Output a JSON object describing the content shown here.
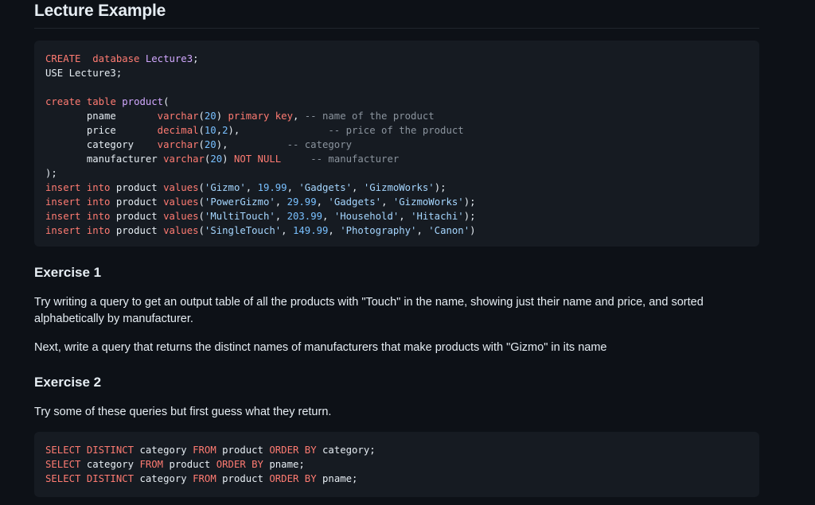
{
  "title": "Lecture Example",
  "lecture_code": [
    [
      [
        "CREATE",
        "kw"
      ],
      [
        "  ",
        ""
      ],
      [
        "database",
        "kw"
      ],
      [
        " ",
        ""
      ],
      [
        "Lecture3",
        "fn"
      ],
      [
        ";",
        ""
      ]
    ],
    [
      [
        "USE Lecture3;",
        ""
      ]
    ],
    [],
    [
      [
        "create",
        "kw"
      ],
      [
        " ",
        ""
      ],
      [
        "table",
        "kw"
      ],
      [
        " ",
        ""
      ],
      [
        "product",
        "fn"
      ],
      [
        "(",
        ""
      ]
    ],
    [
      [
        "       pname       ",
        ""
      ],
      [
        "varchar",
        "kw"
      ],
      [
        "(",
        ""
      ],
      [
        "20",
        "num"
      ],
      [
        ") ",
        ""
      ],
      [
        "primary key",
        "kw"
      ],
      [
        ", ",
        ""
      ],
      [
        "-- name of the product",
        "cm"
      ]
    ],
    [
      [
        "       price       ",
        ""
      ],
      [
        "decimal",
        "kw"
      ],
      [
        "(",
        ""
      ],
      [
        "10",
        "num"
      ],
      [
        ",",
        ""
      ],
      [
        "2",
        "num"
      ],
      [
        "),               ",
        ""
      ],
      [
        "-- price of the product",
        "cm"
      ]
    ],
    [
      [
        "       category    ",
        ""
      ],
      [
        "varchar",
        "kw"
      ],
      [
        "(",
        ""
      ],
      [
        "20",
        "num"
      ],
      [
        "),          ",
        ""
      ],
      [
        "-- category",
        "cm"
      ]
    ],
    [
      [
        "       manufacturer ",
        ""
      ],
      [
        "varchar",
        "kw"
      ],
      [
        "(",
        ""
      ],
      [
        "20",
        "num"
      ],
      [
        ") ",
        ""
      ],
      [
        "NOT NULL",
        "kw"
      ],
      [
        "     ",
        ""
      ],
      [
        "-- manufacturer",
        "cm"
      ]
    ],
    [
      [
        ");",
        ""
      ]
    ],
    [
      [
        "insert",
        "kw"
      ],
      [
        " ",
        ""
      ],
      [
        "into",
        "kw"
      ],
      [
        " product ",
        ""
      ],
      [
        "values",
        "kw"
      ],
      [
        "(",
        ""
      ],
      [
        "'Gizmo'",
        "str"
      ],
      [
        ", ",
        ""
      ],
      [
        "19.99",
        "num"
      ],
      [
        ", ",
        ""
      ],
      [
        "'Gadgets'",
        "str"
      ],
      [
        ", ",
        ""
      ],
      [
        "'GizmoWorks'",
        "str"
      ],
      [
        ");",
        ""
      ]
    ],
    [
      [
        "insert",
        "kw"
      ],
      [
        " ",
        ""
      ],
      [
        "into",
        "kw"
      ],
      [
        " product ",
        ""
      ],
      [
        "values",
        "kw"
      ],
      [
        "(",
        ""
      ],
      [
        "'PowerGizmo'",
        "str"
      ],
      [
        ", ",
        ""
      ],
      [
        "29.99",
        "num"
      ],
      [
        ", ",
        ""
      ],
      [
        "'Gadgets'",
        "str"
      ],
      [
        ", ",
        ""
      ],
      [
        "'GizmoWorks'",
        "str"
      ],
      [
        ");",
        ""
      ]
    ],
    [
      [
        "insert",
        "kw"
      ],
      [
        " ",
        ""
      ],
      [
        "into",
        "kw"
      ],
      [
        " product ",
        ""
      ],
      [
        "values",
        "kw"
      ],
      [
        "(",
        ""
      ],
      [
        "'MultiTouch'",
        "str"
      ],
      [
        ", ",
        ""
      ],
      [
        "203.99",
        "num"
      ],
      [
        ", ",
        ""
      ],
      [
        "'Household'",
        "str"
      ],
      [
        ", ",
        ""
      ],
      [
        "'Hitachi'",
        "str"
      ],
      [
        ");",
        ""
      ]
    ],
    [
      [
        "insert",
        "kw"
      ],
      [
        " ",
        ""
      ],
      [
        "into",
        "kw"
      ],
      [
        " product ",
        ""
      ],
      [
        "values",
        "kw"
      ],
      [
        "(",
        ""
      ],
      [
        "'SingleTouch'",
        "str"
      ],
      [
        ", ",
        ""
      ],
      [
        "149.99",
        "num"
      ],
      [
        ", ",
        ""
      ],
      [
        "'Photography'",
        "str"
      ],
      [
        ", ",
        ""
      ],
      [
        "'Canon'",
        "str"
      ],
      [
        ")",
        ""
      ]
    ]
  ],
  "exercise1": {
    "heading": "Exercise 1",
    "para1": "Try writing a query to get an output table of all the products with \"Touch\" in the name, showing just their name and price, and sorted alphabetically by manufacturer.",
    "para2": "Next, write a query that returns the distinct names of manufacturers that make products with \"Gizmo\" in its name"
  },
  "exercise2": {
    "heading": "Exercise 2",
    "para1": "Try some of these queries but first guess what they return."
  },
  "exercise2_code": [
    [
      [
        "SELECT DISTINCT",
        "kw"
      ],
      [
        " category ",
        ""
      ],
      [
        "FROM",
        "kw"
      ],
      [
        " product ",
        ""
      ],
      [
        "ORDER BY",
        "kw"
      ],
      [
        " category;",
        ""
      ]
    ],
    [
      [
        "SELECT",
        "kw"
      ],
      [
        " category ",
        ""
      ],
      [
        "FROM",
        "kw"
      ],
      [
        " product ",
        ""
      ],
      [
        "ORDER BY",
        "kw"
      ],
      [
        " pname;",
        ""
      ]
    ],
    [
      [
        "SELECT DISTINCT",
        "kw"
      ],
      [
        " category ",
        ""
      ],
      [
        "FROM",
        "kw"
      ],
      [
        " product ",
        ""
      ],
      [
        "ORDER BY",
        "kw"
      ],
      [
        " pname;",
        ""
      ]
    ]
  ],
  "colors": {
    "keyword": "#ff7b72",
    "function": "#d2a8ff",
    "number": "#79c0ff",
    "string": "#a5d6ff",
    "comment": "#8b949e",
    "background": "#0d1117",
    "code_background": "#161b22"
  }
}
